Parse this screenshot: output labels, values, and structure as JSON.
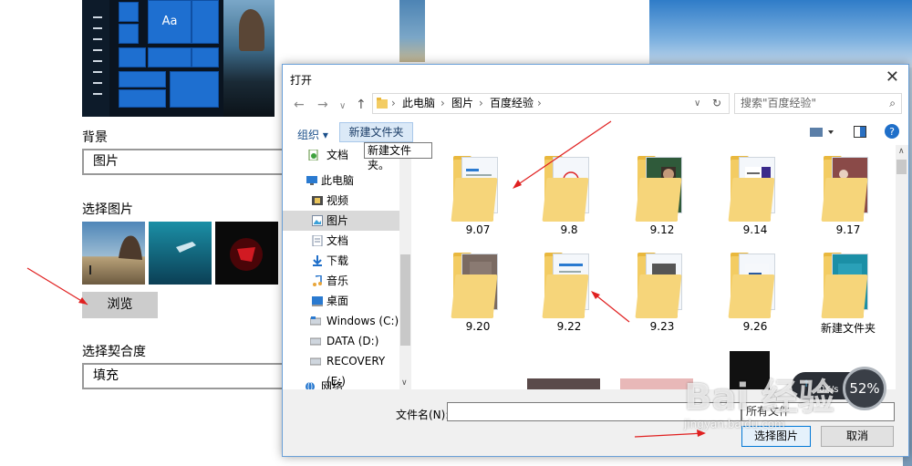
{
  "settings": {
    "background_label": "背景",
    "background_value": "图片",
    "choose_picture_label": "选择图片",
    "browse_label": "浏览",
    "fit_label": "选择契合度",
    "fit_value": "填充",
    "preview_tile_text": "Aa"
  },
  "dialog": {
    "title": "打开",
    "close_glyph": "✕",
    "breadcrumb": [
      "此电脑",
      "图片",
      "百度经验"
    ],
    "search_placeholder": "搜索\"百度经验\"",
    "toolbar": {
      "organize_label": "组织 ▾",
      "new_folder_label": "新建文件夹",
      "tooltip": "新建文件夹。"
    },
    "nav_items": [
      {
        "label": "文档",
        "icon": "documents-icon"
      },
      {
        "label": "此电脑",
        "icon": "computer-icon"
      },
      {
        "label": "视频",
        "icon": "videos-icon"
      },
      {
        "label": "图片",
        "icon": "pictures-icon",
        "selected": true
      },
      {
        "label": "文档",
        "icon": "documents-icon"
      },
      {
        "label": "下载",
        "icon": "downloads-icon"
      },
      {
        "label": "音乐",
        "icon": "music-icon"
      },
      {
        "label": "桌面",
        "icon": "desktop-icon"
      },
      {
        "label": "Windows (C:)",
        "icon": "drive-icon"
      },
      {
        "label": "DATA (D:)",
        "icon": "drive-icon"
      },
      {
        "label": "RECOVERY (E:)",
        "icon": "drive-icon"
      },
      {
        "label": "网络",
        "icon": "network-icon"
      }
    ],
    "folders": [
      "9.07",
      "9.8",
      "9.12",
      "9.14",
      "9.17",
      "9.20",
      "9.22",
      "9.23",
      "9.26",
      "新建文件夹"
    ],
    "filename_label": "文件名(N):",
    "filter_value": "所有文件",
    "open_button": "选择图片",
    "cancel_button": "取消"
  },
  "widget": {
    "speed": "0K/s",
    "percent": "52%"
  },
  "watermark": {
    "brand": "Bai 经验",
    "url": "jingyan.baidu.com"
  },
  "colors": {
    "accent": "#0078d7",
    "tile_blue": "#1e6fd0",
    "annotation_red": "#e02020",
    "folder_yellow": "#f3cc63"
  }
}
